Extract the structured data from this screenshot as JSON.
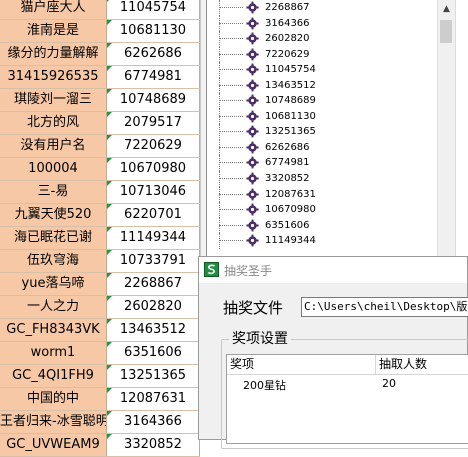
{
  "spreadsheet": {
    "rows": [
      {
        "name": "猫户座大人",
        "id": "11045754"
      },
      {
        "name": "淮南是是",
        "id": "10681130"
      },
      {
        "name": "缘分的力量解解",
        "id": "6262686"
      },
      {
        "name": "31415926535",
        "id": "6774981"
      },
      {
        "name": "琪陵刘一溜三",
        "id": "10748689"
      },
      {
        "name": "北方的风",
        "id": "2079517"
      },
      {
        "name": "没有用户名",
        "id": "7220629"
      },
      {
        "name": "100004",
        "id": "10670980"
      },
      {
        "name": "三-易",
        "id": "10713046"
      },
      {
        "name": "九翼天使520",
        "id": "6220701"
      },
      {
        "name": "海已眠花已谢",
        "id": "11149344"
      },
      {
        "name": "伍玖穹海",
        "id": "10733791"
      },
      {
        "name": "yue落乌啼",
        "id": "2268867"
      },
      {
        "name": "一人之力",
        "id": "2602820"
      },
      {
        "name": "GC_FH8343VK",
        "id": "13463512"
      },
      {
        "name": "worm1",
        "id": "6351606"
      },
      {
        "name": "GC_4QI1FH9",
        "id": "13251365"
      },
      {
        "name": "中国的中",
        "id": "12087631"
      },
      {
        "name": "王者归来-冰雪聪明",
        "id": "3164366"
      },
      {
        "name": "GC_UVWEAM9",
        "id": "3320852"
      }
    ]
  },
  "tree_list": {
    "items": [
      "2268867",
      "3164366",
      "2602820",
      "7220629",
      "11045754",
      "13463512",
      "10748689",
      "10681130",
      "13251365",
      "6262686",
      "6774981",
      "3320852",
      "12087631",
      "10670980",
      "6351606",
      "11149344"
    ],
    "icon": "purple-gear-icon"
  },
  "dialog": {
    "title": "抽奖圣手",
    "app_icon": "green-s-logo-icon",
    "file_label": "抽奖文件",
    "file_path": "C:\\Users\\cheil\\Desktop\\版块",
    "group_label": "奖项设置",
    "table": {
      "headers": [
        "奖项",
        "抽取人数"
      ],
      "rows": [
        [
          "200星钻",
          "20"
        ]
      ]
    }
  }
}
